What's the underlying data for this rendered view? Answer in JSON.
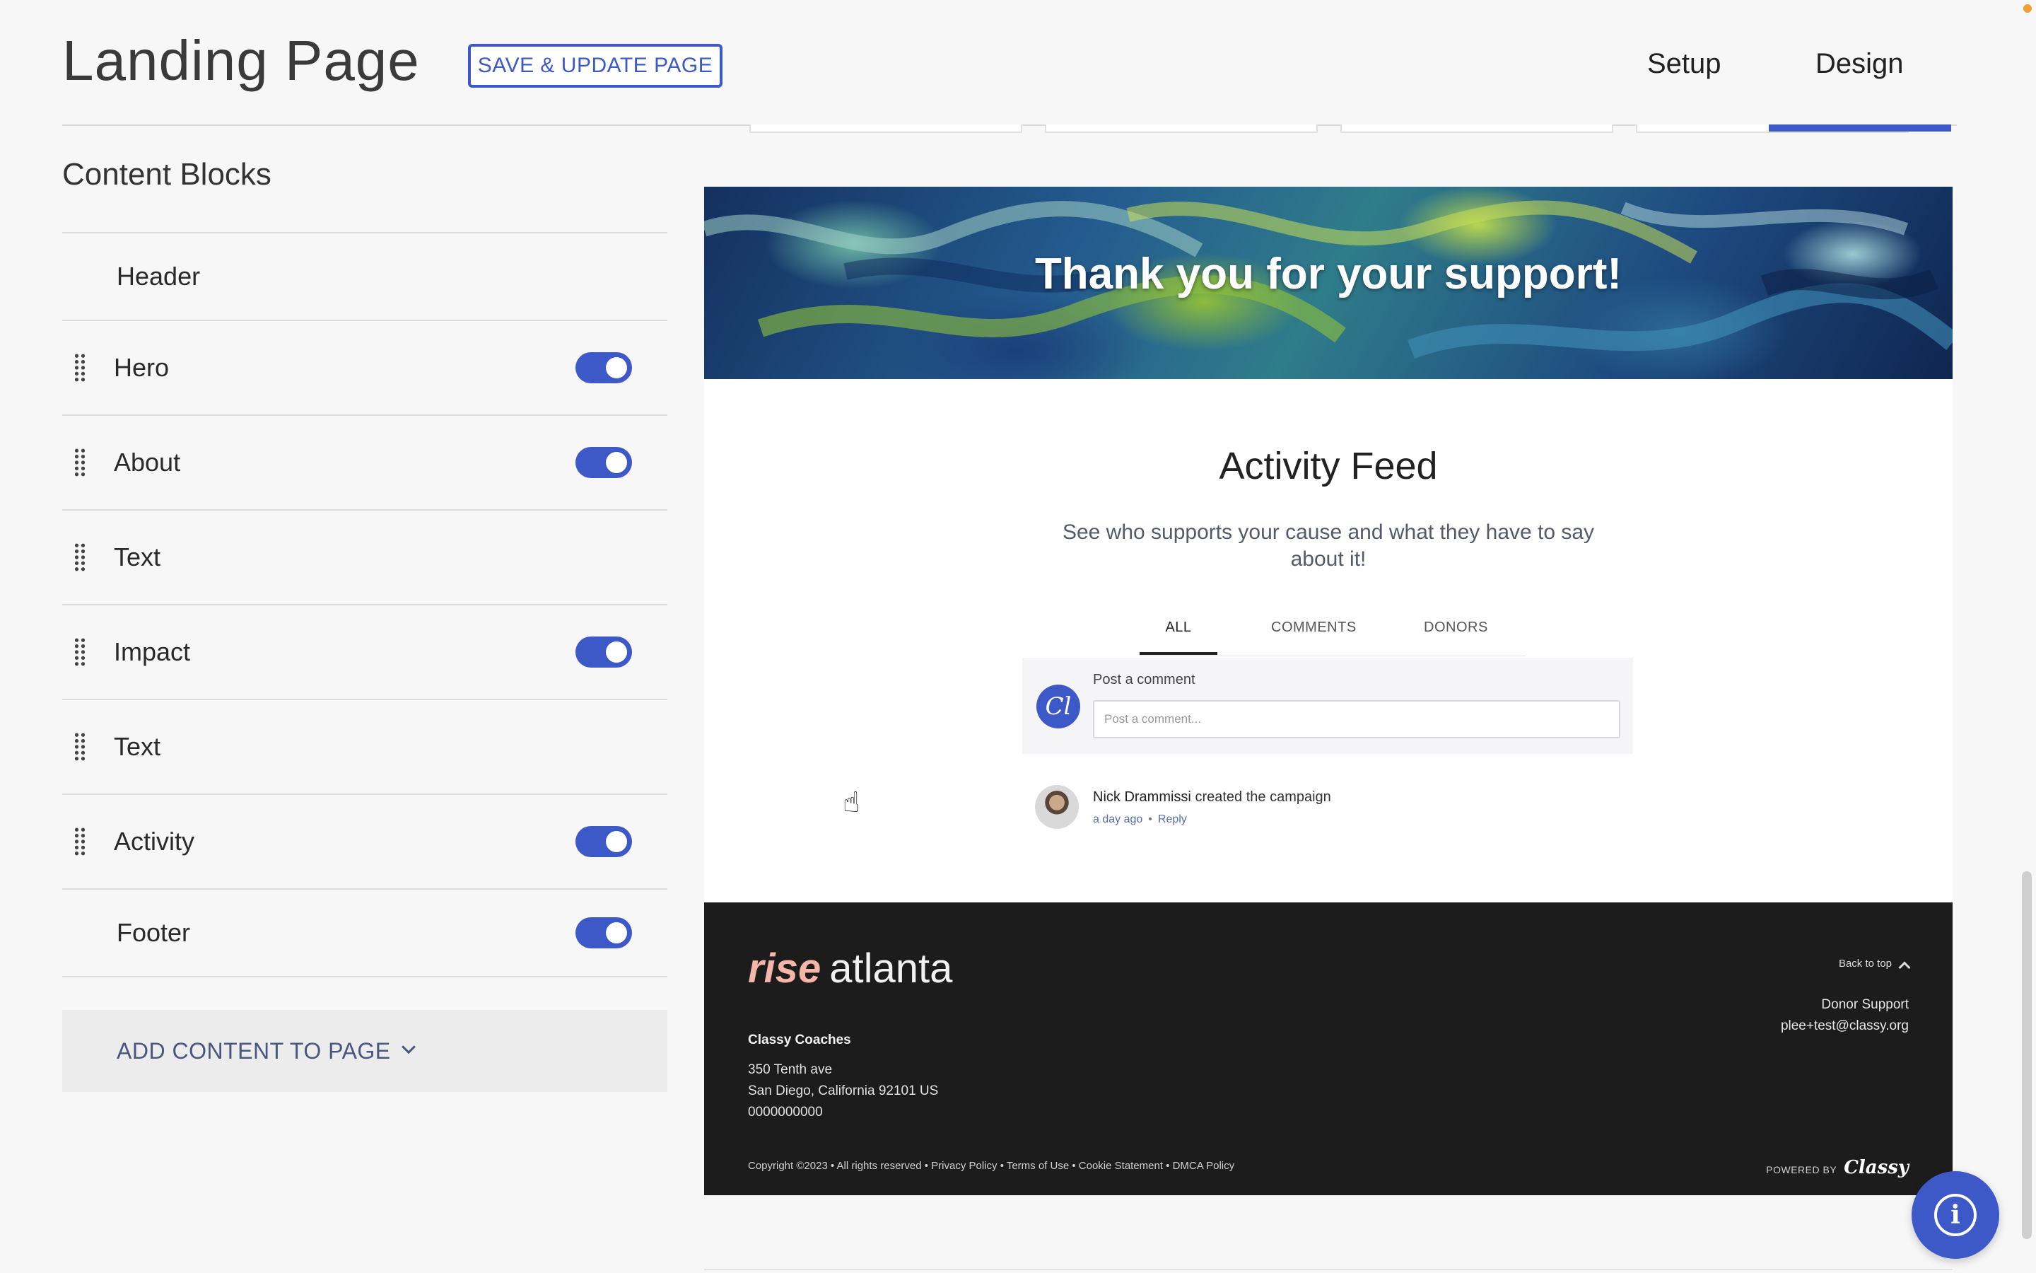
{
  "header": {
    "title": "Landing Page",
    "save_label": "SAVE & UPDATE PAGE",
    "nav": [
      {
        "label": "Setup"
      },
      {
        "label": "Design"
      }
    ]
  },
  "sidebar": {
    "title": "Content Blocks",
    "blocks": [
      {
        "label": "Header",
        "draggable": false,
        "toggle": null
      },
      {
        "label": "Hero",
        "draggable": true,
        "toggle": true
      },
      {
        "label": "About",
        "draggable": true,
        "toggle": true
      },
      {
        "label": "Text",
        "draggable": true,
        "toggle": null
      },
      {
        "label": "Impact",
        "draggable": true,
        "toggle": true
      },
      {
        "label": "Text",
        "draggable": true,
        "toggle": null
      },
      {
        "label": "Activity",
        "draggable": true,
        "toggle": true
      },
      {
        "label": "Footer",
        "draggable": false,
        "toggle": true
      }
    ],
    "add_content_label": "ADD CONTENT TO PAGE"
  },
  "preview": {
    "hero_title": "Thank you for your support!",
    "feed": {
      "title": "Activity Feed",
      "subtitle": "See who supports your cause and what they have to say about it!",
      "tabs": [
        {
          "label": "ALL",
          "active": true
        },
        {
          "label": "COMMENTS",
          "active": false
        },
        {
          "label": "DONORS",
          "active": false
        }
      ],
      "comment": {
        "avatar_text": "Cl",
        "label": "Post a comment",
        "placeholder": "Post a comment..."
      },
      "activity": {
        "name": "Nick Drammissi",
        "action": "created the campaign",
        "time": "a day ago",
        "reply": "Reply",
        "separator": "•"
      }
    },
    "footer": {
      "logo_rise": "rise",
      "logo_atlanta": "atlanta",
      "org_name": "Classy Coaches",
      "address_1": "350 Tenth ave",
      "address_2": "San Diego, California 92101 US",
      "phone": "0000000000",
      "back_to_top": "Back to top",
      "donor_support": "Donor Support",
      "email": "plee+test@classy.org",
      "copyright": "Copyright ©2023 • All rights reserved • Privacy Policy • Terms of Use • Cookie Statement • DMCA Policy",
      "powered_label": "POWERED BY",
      "powered_brand": "Classy"
    }
  },
  "icons": {
    "info": "info-icon",
    "cursor": "hand-pointer-icon",
    "drag": "drag-handle-icon"
  },
  "colors": {
    "accent": "#3d58c7",
    "footer_bg": "#1c1c1c",
    "logo_accent": "#f3b6a8"
  }
}
